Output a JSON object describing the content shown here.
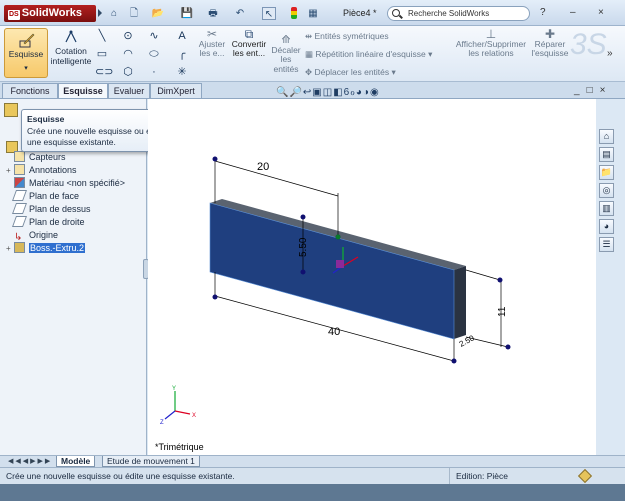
{
  "app": {
    "logo_text": "SolidWorks",
    "logo_badge": "DS"
  },
  "titlebar": {
    "doc_title": "Pièce4 *",
    "search_placeholder": "Recherche SolidWorks",
    "help_label": "?",
    "min_label": "–",
    "close_label": "×"
  },
  "ribbon": {
    "esquisse": "Esquisse",
    "cotation": "Cotation intelligente",
    "ajuster": "Ajuster les e...",
    "convertir": "Convertir les ent...",
    "decaler": "Décaler les entités",
    "entites_sym": "Entités symétriques",
    "repetition": "Répétition linéaire d'esquisse",
    "deplacer": "Déplacer les entités",
    "afficher": "Afficher/Supprimer les relations",
    "reparer": "Réparer l'esquisse",
    "more": "»"
  },
  "tabs": [
    {
      "label": "Fonctions",
      "active": false
    },
    {
      "label": "Esquisse",
      "active": true
    },
    {
      "label": "Evaluer",
      "active": false
    },
    {
      "label": "DimXpert",
      "active": false
    }
  ],
  "tooltip": {
    "title": "Esquisse",
    "text": "Crée une nouvelle esquisse ou édite une esquisse existante."
  },
  "tree": [
    {
      "label": "Capteurs",
      "icon": "sensor-icon",
      "expand": ""
    },
    {
      "label": "Annotations",
      "icon": "annotation-icon",
      "expand": "+"
    },
    {
      "label": "Matériau <non spécifié>",
      "icon": "material-icon",
      "expand": ""
    },
    {
      "label": "Plan de face",
      "icon": "plane-icon",
      "expand": ""
    },
    {
      "label": "Plan de dessus",
      "icon": "plane-icon",
      "expand": ""
    },
    {
      "label": "Plan de droite",
      "icon": "plane-icon",
      "expand": ""
    },
    {
      "label": "Origine",
      "icon": "origin-icon",
      "expand": ""
    },
    {
      "label": "Boss.-Extru.2",
      "icon": "extrude-icon",
      "expand": "+",
      "selected": true
    }
  ],
  "viewport": {
    "view_name": "*Trimétrique",
    "dims": {
      "top": "20",
      "bottom": "40",
      "right": "11",
      "vertical": "5.50",
      "small": "2.50"
    }
  },
  "bottom_tabs": [
    {
      "label": "Modèle",
      "active": true
    },
    {
      "label": "Etude de mouvement 1",
      "active": false
    }
  ],
  "status": {
    "message": "Crée une nouvelle esquisse ou édite une esquisse existante.",
    "edition": "Edition: Pièce"
  },
  "colors": {
    "part_face": "#1f3f7f",
    "accent": "#2f6fcf",
    "sketch_point": "#101070"
  }
}
